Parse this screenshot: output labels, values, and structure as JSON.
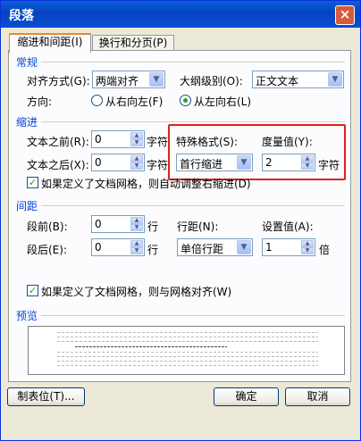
{
  "window": {
    "title": "段落",
    "close_symbol": "×"
  },
  "tabs": [
    {
      "label": "缩进和间距(I)",
      "active": true
    },
    {
      "label": "换行和分页(P)",
      "active": false
    }
  ],
  "general": {
    "section": "常规",
    "alignment_label": "对齐方式(G):",
    "alignment_value": "两端对齐",
    "outline_label": "大纲级别(O):",
    "outline_value": "正文文本",
    "direction_label": "方向:",
    "rtl_label": "从右向左(F)",
    "ltr_label": "从左向右(L)",
    "selected_direction": "ltr"
  },
  "indent": {
    "section": "缩进",
    "before_label": "文本之前(R):",
    "before_value": "0",
    "before_unit": "字符",
    "after_label": "文本之后(X):",
    "after_value": "0",
    "after_unit": "字符",
    "special_label": "特殊格式(S):",
    "special_value": "首行缩进",
    "by_label": "度量值(Y):",
    "by_value": "2",
    "by_unit": "字符",
    "auto_adjust_label": "如果定义了文档网格，则自动调整右缩进(D)",
    "auto_adjust_checked": true
  },
  "spacing": {
    "section": "间距",
    "before_label": "段前(B):",
    "before_value": "0",
    "before_unit": "行",
    "after_label": "段后(E):",
    "after_value": "0",
    "after_unit": "行",
    "line_label": "行距(N):",
    "line_value": "单倍行距",
    "at_label": "设置值(A):",
    "at_value": "1",
    "at_unit": "倍",
    "snap_label": "如果定义了文档网格，则与网格对齐(W)",
    "snap_checked": true
  },
  "preview": {
    "section": "预览"
  },
  "buttons": {
    "tabs": "制表位(T)...",
    "ok": "确定",
    "cancel": "取消"
  },
  "colors": {
    "title_bar": "#0a4ed3",
    "section_text": "#0046d5",
    "highlight_box": "#e02020",
    "check_mark": "#21a121"
  }
}
